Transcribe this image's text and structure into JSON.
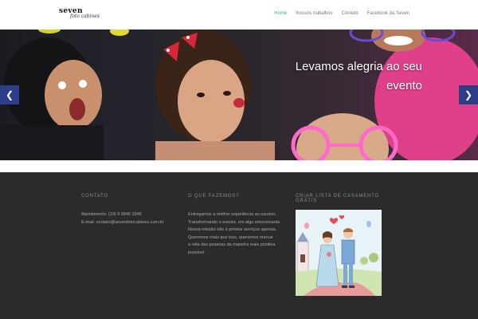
{
  "header": {
    "logo_main": "seven",
    "logo_sub": "foto cabines",
    "nav": [
      "Home",
      "Nossos trabalhos",
      "Contato",
      "Facebook da Seven"
    ],
    "active_color": "#2bb3a3"
  },
  "hero": {
    "caption_line1": "Levamos alegria ao seu",
    "caption_line2": "evento",
    "prev_icon": "chevron-left-icon",
    "next_icon": "chevron-right-icon",
    "arrow_color": "#2c3e88"
  },
  "footer": {
    "contact": {
      "heading": "CONTATO",
      "line1": "Atendimento: (19) 9 9845 3345",
      "line2": "E-mail: contato@sevenfotocabines.com.br"
    },
    "about": {
      "heading": "O QUE FAZEMOS?",
      "lines": [
        "Entregamos a melhor experiência ao usuário.",
        "Transformando o evento, em algo emocionante.",
        "Nossa missão não é prestar serviços apenas.",
        "Queremos mais que isso, queremos marcar",
        "a vida das pessoas da maneira mais positiva",
        "possível."
      ]
    },
    "wedding": {
      "heading": "CRIAR LISTA DE CASAMENTO GRÁTIS"
    },
    "bg_color": "#2b2b2b"
  }
}
